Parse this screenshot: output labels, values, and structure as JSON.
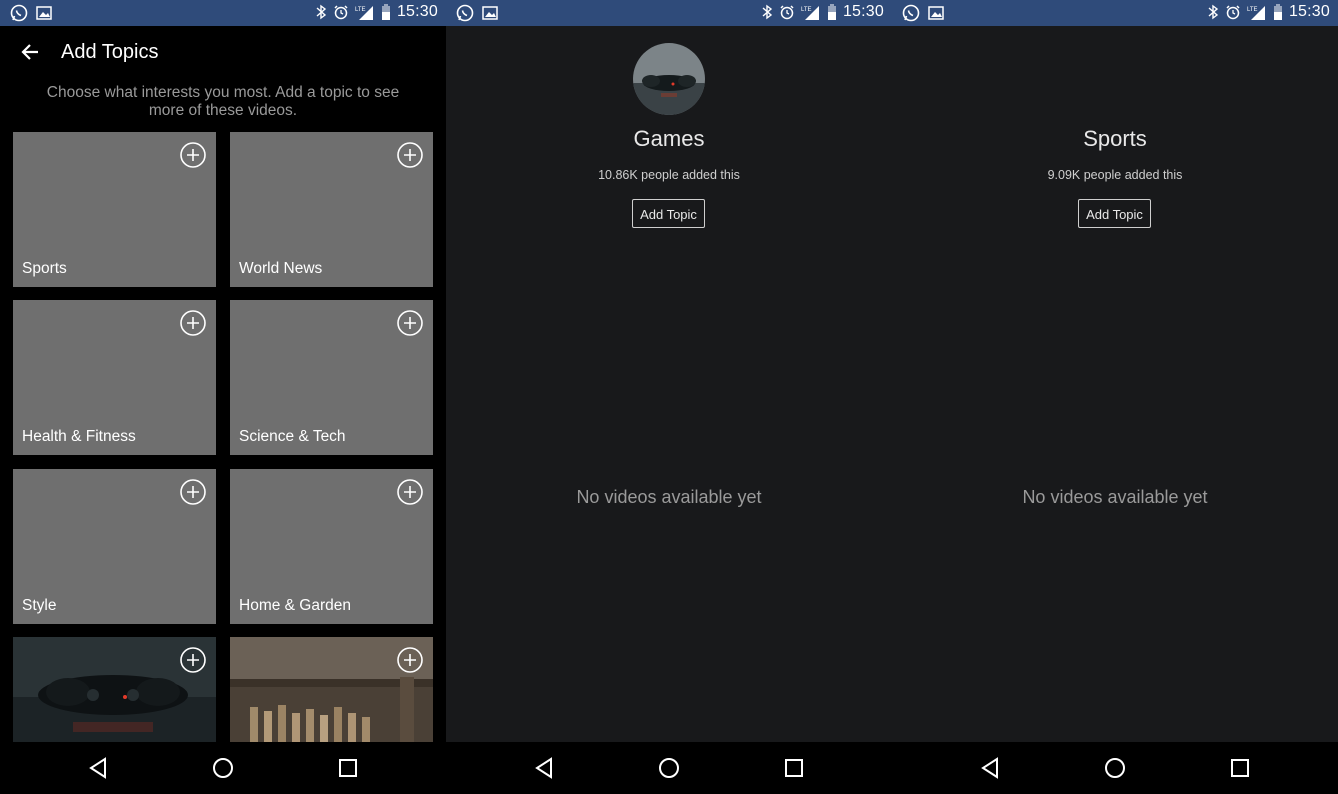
{
  "status": {
    "time": "15:30"
  },
  "add_topics": {
    "title": "Add Topics",
    "subtitle": "Choose what interests you most. Add a topic to see more of these videos.",
    "tiles": [
      {
        "label": "Sports"
      },
      {
        "label": "World News"
      },
      {
        "label": "Health & Fitness"
      },
      {
        "label": "Science & Tech"
      },
      {
        "label": "Style"
      },
      {
        "label": "Home & Garden"
      }
    ]
  },
  "games": {
    "title": "Games",
    "added": "10.86K people added this",
    "button": "Add Topic",
    "empty": "No videos available yet"
  },
  "sports": {
    "title": "Sports",
    "added": "9.09K people added this",
    "button": "Add Topic",
    "empty": "No videos available yet"
  },
  "colors": {
    "status_bar": "#2f4b7a",
    "tile": "#6f6f6f",
    "detail_bg": "#18191b"
  }
}
